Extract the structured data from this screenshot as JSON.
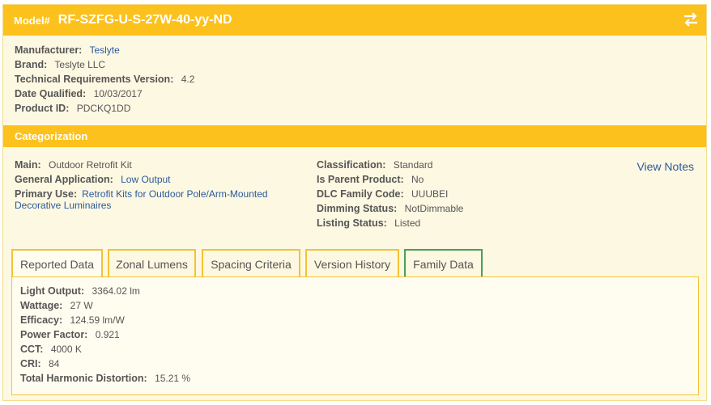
{
  "model": {
    "key": "Model#",
    "value": "RF-SZFG-U-S-27W-40-yy-ND",
    "swap_icon": "swap-arrows-icon"
  },
  "product": {
    "manufacturer": {
      "label": "Manufacturer:",
      "value": "Teslyte"
    },
    "brand": {
      "label": "Brand:",
      "value": "Teslyte LLC"
    },
    "tech_req": {
      "label": "Technical Requirements Version:",
      "value": "4.2"
    },
    "date_qualified": {
      "label": "Date Qualified:",
      "value": "10/03/2017"
    },
    "product_id": {
      "label": "Product ID:",
      "value": "PDCKQ1DD"
    }
  },
  "categorization": {
    "title": "Categorization",
    "main": {
      "label": "Main:",
      "value": "Outdoor Retrofit Kit"
    },
    "general_app": {
      "label": "General Application:",
      "value": "Low Output"
    },
    "primary_use": {
      "label": "Primary Use:",
      "value": "Retrofit Kits for Outdoor Pole/Arm-Mounted Decorative Luminaires"
    },
    "classification": {
      "label": "Classification:",
      "value": "Standard"
    },
    "is_parent": {
      "label": "Is Parent Product:",
      "value": "No"
    },
    "family_code": {
      "label": "DLC Family Code:",
      "value": "UUUBEI"
    },
    "dimming": {
      "label": "Dimming Status:",
      "value": "NotDimmable"
    },
    "listing": {
      "label": "Listing Status:",
      "value": "Listed"
    },
    "view_notes": "View Notes"
  },
  "tabs": [
    "Reported Data",
    "Zonal Lumens",
    "Spacing Criteria",
    "Version History",
    "Family Data"
  ],
  "reported": {
    "light_output": {
      "label": "Light Output:",
      "value": "3364.02 lm"
    },
    "wattage": {
      "label": "Wattage:",
      "value": "27 W"
    },
    "efficacy": {
      "label": "Efficacy:",
      "value": "124.59 lm/W"
    },
    "power_factor": {
      "label": "Power Factor:",
      "value": "0.921"
    },
    "cct": {
      "label": "CCT:",
      "value": "4000 K"
    },
    "cri": {
      "label": "CRI:",
      "value": "84"
    },
    "thd": {
      "label": "Total Harmonic Distortion:",
      "value": "15.21 %"
    }
  },
  "colors": {
    "accent": "#fcc11c",
    "background": "#fdf8e2",
    "link": "#2a5a9e",
    "family_tab": "#4aa05a"
  }
}
